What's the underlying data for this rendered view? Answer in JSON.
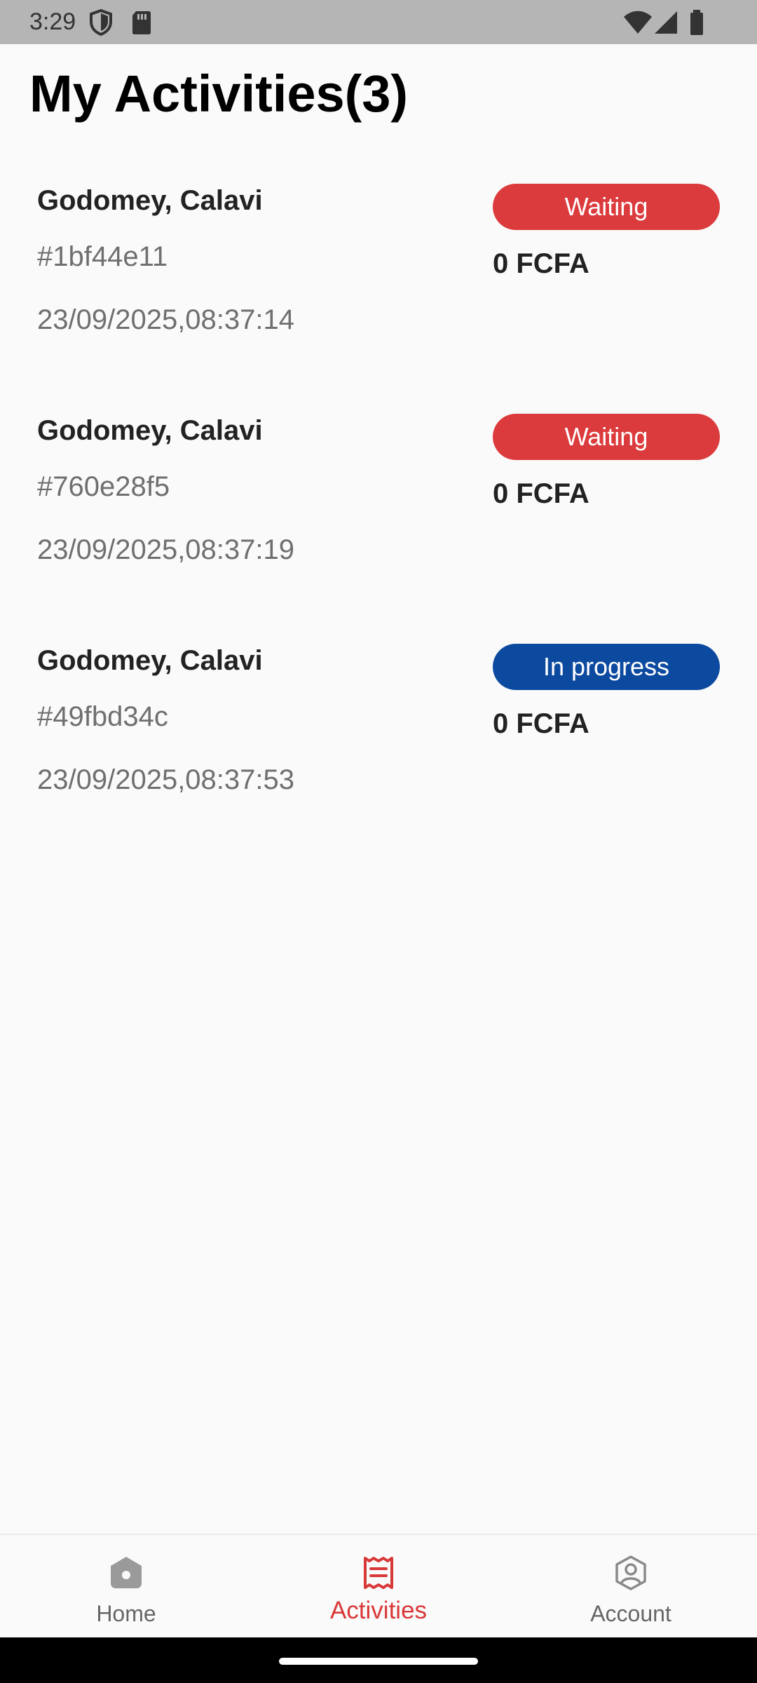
{
  "status_bar": {
    "time": "3:29"
  },
  "header": {
    "title": "My Activities(3)"
  },
  "activities": [
    {
      "location": "Godomey, Calavi",
      "id": "#1bf44e11",
      "date": "23/09/2025,08:37:14",
      "status": "Waiting",
      "status_color": "#dc3b3d",
      "amount": "0 FCFA"
    },
    {
      "location": "Godomey, Calavi",
      "id": "#760e28f5",
      "date": "23/09/2025,08:37:19",
      "status": "Waiting",
      "status_color": "#dc3b3d",
      "amount": "0 FCFA"
    },
    {
      "location": "Godomey, Calavi",
      "id": "#49fbd34c",
      "date": "23/09/2025,08:37:53",
      "status": "In progress",
      "status_color": "#0c4aa0",
      "amount": "0 FCFA"
    }
  ],
  "bottom_nav": {
    "items": [
      {
        "label": "Home",
        "icon": "home-icon",
        "active": false
      },
      {
        "label": "Activities",
        "icon": "activities-icon",
        "active": true
      },
      {
        "label": "Account",
        "icon": "account-icon",
        "active": false
      }
    ],
    "active_color": "#d93838",
    "inactive_color": "#666666"
  }
}
